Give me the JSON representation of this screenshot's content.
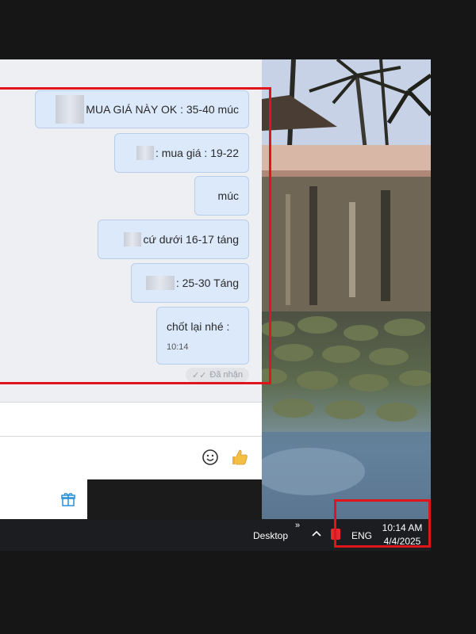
{
  "chat": {
    "messages": [
      {
        "text": "MUA GIÁ NÀY OK : 35-40 múc"
      },
      {
        "text": ": mua giá : 19-22"
      },
      {
        "text": "múc"
      },
      {
        "text": "cứ dưới 16-17 táng"
      },
      {
        "text": ": 25-30 Táng"
      },
      {
        "text": "chốt lại nhé :",
        "time": "10:14"
      }
    ],
    "status": "Đã nhận"
  },
  "taskbar": {
    "desktop_label": "Desktop",
    "more_glyph": "»",
    "language": "ENG",
    "time": "10:14 AM",
    "date": "4/4/2025"
  },
  "colors": {
    "highlight": "#e0141b",
    "bubble": "#dbe9fb",
    "bubble_border": "#b8cde7",
    "taskbar": "#1c1d20"
  }
}
